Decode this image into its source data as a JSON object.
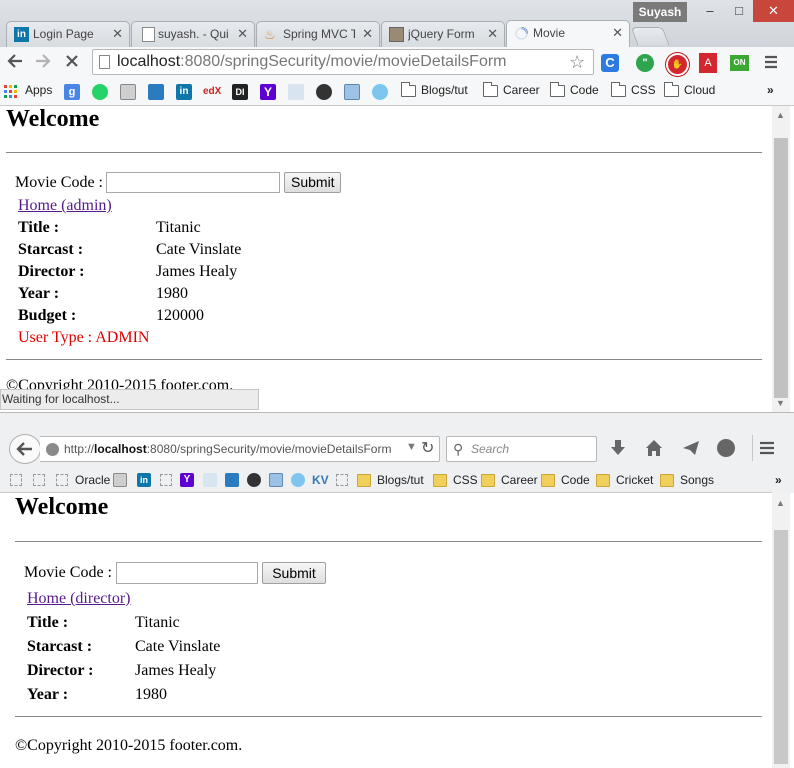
{
  "chrome": {
    "user_name": "Suyash",
    "tabs": [
      {
        "label": "Login Page",
        "icon": "linkedin-icon"
      },
      {
        "label": "suyash. - Qui",
        "icon": "page-icon"
      },
      {
        "label": "Spring MVC T",
        "icon": "java-icon"
      },
      {
        "label": "jQuery Form",
        "icon": "profile-image-icon"
      },
      {
        "label": "Movie",
        "icon": "loading-spinner-icon",
        "active": true
      }
    ],
    "url_host": "localhost",
    "url_rest": ":8080/springSecurity/movie/movieDetailsForm",
    "bookmarks": {
      "apps_label": "Apps",
      "folders": [
        "Blogs/tut",
        "Career",
        "Code",
        "CSS",
        "Cloud"
      ],
      "overflow": "»"
    },
    "extension_badge": "ON",
    "status_text": "Waiting for localhost..."
  },
  "chrome_page": {
    "heading": "Welcome",
    "movie_code_label": "Movie Code :",
    "movie_code_value": "",
    "submit_label": "Submit",
    "home_link": "Home (admin)",
    "details": [
      {
        "key": "Title :",
        "value": "Titanic"
      },
      {
        "key": "Starcast :",
        "value": "Cate Vinslate"
      },
      {
        "key": "Director :",
        "value": "James Healy"
      },
      {
        "key": "Year :",
        "value": "1980"
      },
      {
        "key": "Budget :",
        "value": "120000"
      }
    ],
    "user_type": "User Type : ADMIN",
    "footer": "©Copyright 2010-2015 footer.com."
  },
  "firefox": {
    "url_prefix": "http://",
    "url_host": "localhost",
    "url_rest": ":8080/springSecurity/movie/movieDetailsForm",
    "search_placeholder": "Search",
    "bookmarks": {
      "oracle": "Oracle",
      "kv": "KV",
      "folders": [
        "Blogs/tut",
        "CSS",
        "Career",
        "Code",
        "Cricket",
        "Songs"
      ],
      "overflow": "»"
    }
  },
  "firefox_page": {
    "heading": "Welcome",
    "movie_code_label": "Movie Code :",
    "movie_code_value": "",
    "submit_label": "Submit",
    "home_link": "Home (director)",
    "details": [
      {
        "key": "Title :",
        "value": "Titanic"
      },
      {
        "key": "Starcast :",
        "value": "Cate Vinslate"
      },
      {
        "key": "Director :",
        "value": "James Healy"
      },
      {
        "key": "Year :",
        "value": "1980"
      }
    ],
    "footer": "©Copyright 2010-2015 footer.com."
  },
  "colors": {
    "link_visited": "#551a8b",
    "user_type_red": "#e00000",
    "chrome_close": "#c9463d"
  }
}
